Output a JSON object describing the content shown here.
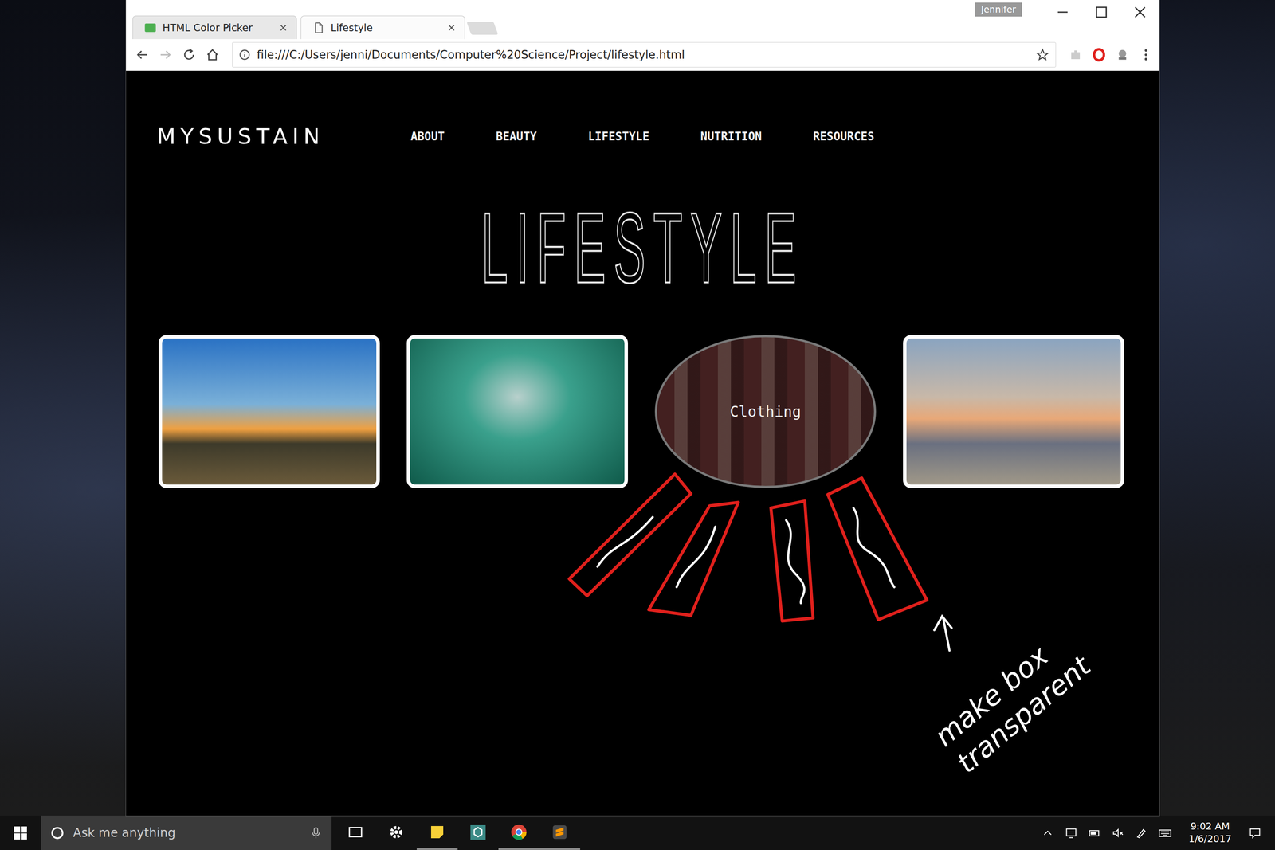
{
  "browser": {
    "profile": "Jennifer",
    "tabs": [
      {
        "label": "HTML Color Picker",
        "selected": false
      },
      {
        "label": "Lifestyle",
        "selected": true
      }
    ],
    "address": "file:///C:/Users/jenni/Documents/Computer%20Science/Project/lifestyle.html"
  },
  "page": {
    "logo": "MYSUSTAIN",
    "nav": [
      {
        "label": "ABOUT"
      },
      {
        "label": "BEAUTY"
      },
      {
        "label": "LIFESTYLE"
      },
      {
        "label": "NUTRITION"
      },
      {
        "label": "RESOURCES"
      }
    ],
    "heading": "LIFESTYLE",
    "cards": [
      {
        "kind": "photo"
      },
      {
        "kind": "photo"
      },
      {
        "kind": "hovered",
        "label": "Clothing"
      },
      {
        "kind": "photo"
      }
    ]
  },
  "annotation": {
    "note": "make box transparent"
  },
  "taskbar": {
    "search_placeholder": "Ask me anything",
    "time": "9:02 AM",
    "date": "1/6/2017"
  }
}
